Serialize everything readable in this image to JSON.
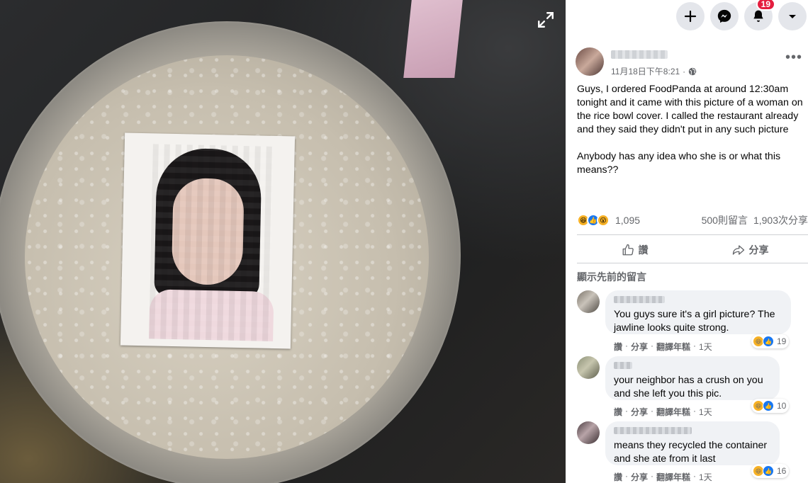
{
  "post": {
    "timestamp": "11月18日下午8:21",
    "text": "Guys, I ordered FoodPanda at around 12:30am tonight and it came with this picture of a woman on the rice bowl cover. I called the restaurant already and they said they didn't put in any such picture\n\nAnybody has any idea who she is or what this means??",
    "reaction_count": "1,095",
    "comment_count": "500則留言",
    "share_count": "1,903次分享"
  },
  "actions": {
    "like": "讚",
    "share": "分享"
  },
  "topbar": {
    "notifications_badge": "19"
  },
  "comments_section": {
    "show_previous": "顯示先前的留言"
  },
  "comments": [
    {
      "text": "You guys sure it's a girl picture? The jawline looks quite strong.",
      "reaction_count": "19",
      "actions": [
        "讚",
        "分享",
        "翻譯年糕"
      ],
      "age": "1天"
    },
    {
      "text": "your neighbor has a crush on you and she left you this pic.",
      "reaction_count": "10",
      "actions": [
        "讚",
        "分享",
        "翻譯年糕"
      ],
      "age": "1天"
    },
    {
      "text": "means they recycled the container and she ate from it last",
      "reaction_count": "16",
      "actions": [
        "讚",
        "分享",
        "翻譯年糕"
      ],
      "age": "1天"
    }
  ],
  "colors": {
    "accent": "#1877f2",
    "badge": "#e41e3f",
    "bubble": "#f0f2f5",
    "secondary_text": "#65676b"
  }
}
